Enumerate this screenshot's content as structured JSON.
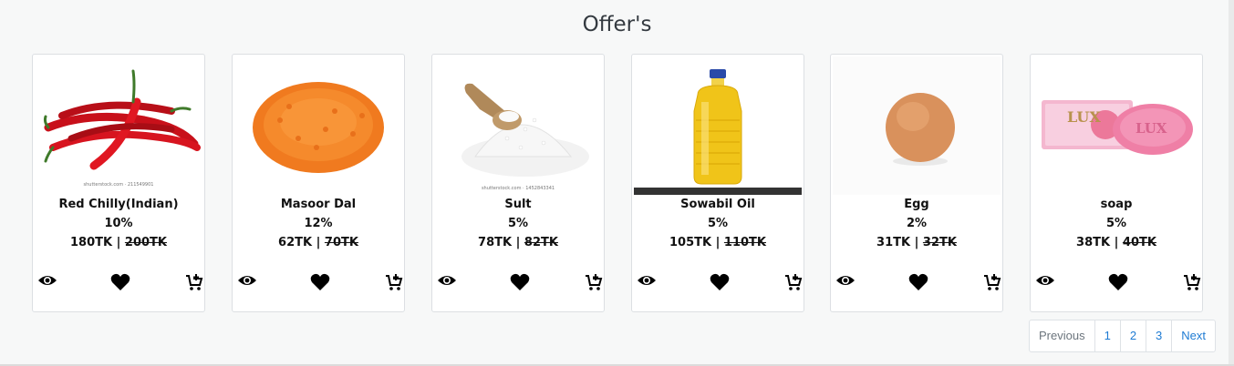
{
  "section": {
    "title": "Offer's"
  },
  "products": [
    {
      "name": "Red Chilly(Indian)",
      "discount": "10%",
      "price": "180TK",
      "old_price": "200TK",
      "watermark": "shutterstock.com · 211549901"
    },
    {
      "name": "Masoor Dal",
      "discount": "12%",
      "price": "62TK",
      "old_price": "70TK"
    },
    {
      "name": "Sult",
      "discount": "5%",
      "price": "78TK",
      "old_price": "82TK",
      "watermark": "shutterstock.com · 1452843341"
    },
    {
      "name": "Sowabil Oil",
      "discount": "5%",
      "price": "105TK",
      "old_price": "110TK"
    },
    {
      "name": "Egg",
      "discount": "2%",
      "price": "31TK",
      "old_price": "32TK"
    },
    {
      "name": "soap",
      "discount": "5%",
      "price": "38TK",
      "old_price": "40TK",
      "brand": "LUX"
    }
  ],
  "separator": " | ",
  "pagination": {
    "previous": "Previous",
    "pages": [
      "1",
      "2",
      "3"
    ],
    "next": "Next"
  },
  "icons": {
    "view": "eye-icon",
    "wishlist": "heart-icon",
    "cart": "add-to-cart-icon"
  }
}
